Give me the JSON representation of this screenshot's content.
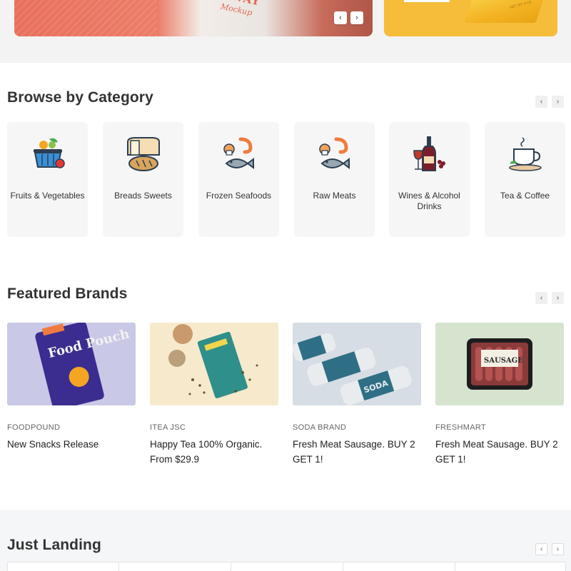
{
  "hero": {
    "banner_text": "AWAY",
    "banner_sub": "Mockup",
    "prev_arrow": "‹",
    "next_arrow": "›",
    "box_text": "NET WT 8 OZ"
  },
  "categories": {
    "title": "Browse by Category",
    "prev": "‹",
    "next": "›",
    "items": [
      {
        "label": "Fruits & Vegetables",
        "icon": "fruit-basket-icon"
      },
      {
        "label": "Breads Sweets",
        "icon": "bread-icon"
      },
      {
        "label": "Frozen Seafoods",
        "icon": "seafood-icon"
      },
      {
        "label": "Raw Meats",
        "icon": "raw-meat-icon"
      },
      {
        "label": "Wines & Alcohol Drinks",
        "icon": "wine-icon"
      },
      {
        "label": "Tea & Coffee",
        "icon": "tea-cup-icon"
      }
    ]
  },
  "brands": {
    "title": "Featured Brands",
    "prev": "‹",
    "next": "›",
    "items": [
      {
        "kicker": "FOODPOUND",
        "name": "New Snacks Release",
        "pouch_text": "Food Pouch"
      },
      {
        "kicker": "ITEA JSC",
        "name": "Happy Tea 100% Organic. From $29.9"
      },
      {
        "kicker": "SODA BRAND",
        "name": "Fresh Meat Sausage. BUY 2 GET 1!",
        "can_text": "SODA"
      },
      {
        "kicker": "FRESHMART",
        "name": "Fresh Meat Sausage. BUY 2 GET 1!",
        "pack_text": "SAUSAGE"
      }
    ]
  },
  "landing": {
    "title": "Just Landing",
    "prev": "‹",
    "next": "›"
  }
}
